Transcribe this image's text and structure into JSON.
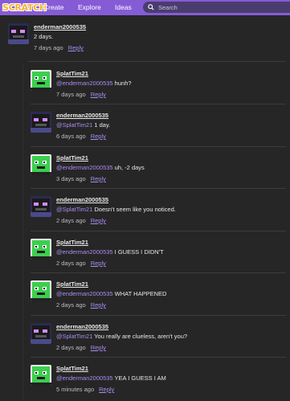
{
  "nav": {
    "logo": "SCRATCH",
    "create": "Create",
    "explore": "Explore",
    "ideas": "Ideas",
    "search_placeholder": "Search"
  },
  "colors": {
    "navbar": "#855cd6",
    "background": "#262626",
    "link": "#a98df0"
  },
  "reply_label": "Reply",
  "comments": [
    {
      "user": "enderman2000535",
      "mention": "",
      "text": "2 days.",
      "time": "7 days ago",
      "avatar": "enderman-avatar"
    },
    {
      "user": "SplatTim21",
      "mention": "@enderman2000535",
      "text": " hunh?",
      "time": "7 days ago",
      "avatar": "splattim-avatar"
    },
    {
      "user": "enderman2000535",
      "mention": "@SplatTim21",
      "text": " 1 day.",
      "time": "6 days ago",
      "avatar": "enderman-avatar"
    },
    {
      "user": "SplatTim21",
      "mention": "@enderman2000535",
      "text": " uh, -2 days",
      "time": "3 days ago",
      "avatar": "splattim-avatar"
    },
    {
      "user": "enderman2000535",
      "mention": "@SplatTim21",
      "text": " Doesn't seem like you noticed.",
      "time": "2 days ago",
      "avatar": "enderman-avatar"
    },
    {
      "user": "SplatTim21",
      "mention": "@enderman2000535",
      "text": " I GUESS I DIDN'T",
      "time": "2 days ago",
      "avatar": "splattim-avatar"
    },
    {
      "user": "SplatTim21",
      "mention": "@enderman2000535",
      "text": " WHAT HAPPENED",
      "time": "2 days ago",
      "avatar": "splattim-avatar"
    },
    {
      "user": "enderman2000535",
      "mention": "@SplatTim21",
      "text": " You really are clueless, aren't you?",
      "time": "2 days ago",
      "avatar": "enderman-avatar"
    },
    {
      "user": "SplatTim21",
      "mention": "@enderman2000535",
      "text": " YEA I GUESS I AM",
      "time": "5 minutes ago",
      "avatar": "splattim-avatar"
    }
  ]
}
